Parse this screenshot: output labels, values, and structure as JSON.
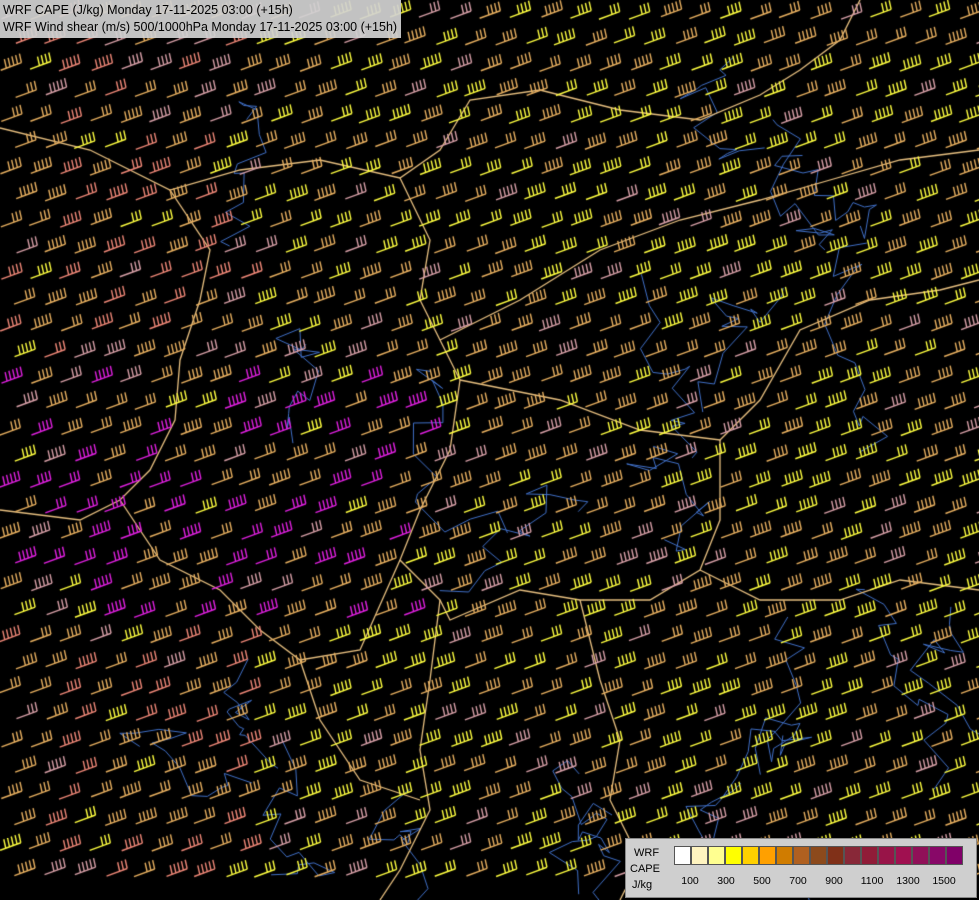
{
  "title": {
    "line1": "WRF CAPE (J/kg) Monday 17-11-2025 03:00 (+15h)",
    "line2": "WRF Wind shear (m/s) 500/1000hPa Monday 17-11-2025 03:00 (+15h)"
  },
  "legend": {
    "row1": "WRF",
    "row2": "CAPE",
    "unit": "J/kg",
    "colors": [
      "#ffffff",
      "#fff4c0",
      "#ffff90",
      "#ffff00",
      "#ffd000",
      "#ffa000",
      "#d07c00",
      "#b06020",
      "#8c4a1c",
      "#803018",
      "#882838",
      "#901c38",
      "#981448",
      "#a01050",
      "#901058",
      "#880868",
      "#800068",
      "#80006a"
    ],
    "ticks": [
      "100",
      "300",
      "500",
      "700",
      "900",
      "1100",
      "1300",
      "1500"
    ]
  },
  "colors": {
    "background": "#000000",
    "barb_tan": "#e8b060",
    "barb_yellow": "#ffff40",
    "barb_salmon": "#f08878",
    "barb_magenta": "#e020e0",
    "barb_pink": "#d8a0a8",
    "border": "#e8c080",
    "river": "#4070c8"
  }
}
